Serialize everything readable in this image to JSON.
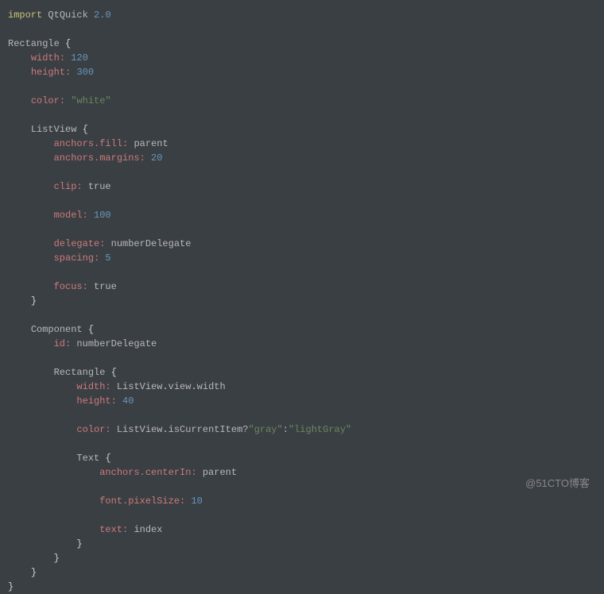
{
  "code": {
    "line1_import": "import",
    "line1_module": "QtQuick",
    "line1_version": "2.0",
    "rect_type": "Rectangle",
    "width_prop": "width:",
    "width_val": "120",
    "height_prop": "height:",
    "height_val": "300",
    "color_prop": "color:",
    "color_val": "\"white\"",
    "listview_type": "ListView",
    "anchors_fill": "anchors.fill:",
    "anchors_fill_val": "parent",
    "anchors_margins": "anchors.margins:",
    "anchors_margins_val": "20",
    "clip_prop": "clip:",
    "clip_val": "true",
    "model_prop": "model:",
    "model_val": "100",
    "delegate_prop": "delegate:",
    "delegate_val": "numberDelegate",
    "spacing_prop": "spacing:",
    "spacing_val": "5",
    "focus_prop": "focus:",
    "focus_val": "true",
    "component_type": "Component",
    "id_prop": "id:",
    "id_val": "numberDelegate",
    "rect2_type": "Rectangle",
    "width2_prop": "width:",
    "width2_val_listview": "ListView",
    "width2_val_view": "view",
    "width2_val_width": "width",
    "height2_prop": "height:",
    "height2_val": "40",
    "color2_prop": "color:",
    "color2_listview": "ListView",
    "color2_iscurrent": "isCurrentItem?",
    "color2_gray": "\"gray\"",
    "color2_colon": ":",
    "color2_lightgray": "\"lightGray\"",
    "text_type": "Text",
    "anchors_centerin": "anchors.centerIn:",
    "anchors_centerin_val": "parent",
    "font_pixelsize": "font.pixelSize:",
    "font_pixelsize_val": "10",
    "text_prop": "text:",
    "text_val": "index"
  },
  "watermark": "@51CTO博客"
}
